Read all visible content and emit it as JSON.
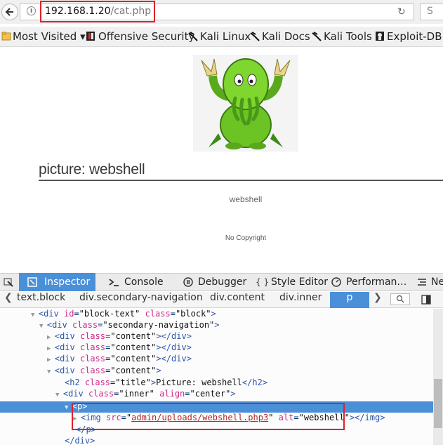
{
  "browser": {
    "url_host": "192.168.1.20",
    "url_path": "/cat.php",
    "search_label": "S"
  },
  "bookmarks": [
    {
      "label": "Most Visited ▾"
    },
    {
      "label": "Offensive Security"
    },
    {
      "label": "Kali Linux"
    },
    {
      "label": "Kali Docs"
    },
    {
      "label": "Kali Tools"
    },
    {
      "label": "Exploit-DB"
    }
  ],
  "page": {
    "title": "picture: webshell",
    "caption": "webshell",
    "copyright": "No Copyright"
  },
  "devtools": {
    "tabs": [
      "Inspector",
      "Console",
      "Debugger",
      "Style Editor",
      "Performan…",
      "Ne"
    ],
    "breadcrumbs": [
      "text.block",
      "div.secondary-navigation",
      "div.content",
      "div.inner",
      "p"
    ],
    "tree": {
      "l0": {
        "tag_open": "<div ",
        "a1": "id",
        "v1": "\"block-text\"",
        "a2": "class",
        "v2": "\"block\"",
        "close": ">"
      },
      "l1": {
        "tag_open": "<div ",
        "a1": "class",
        "v1": "\"secondary-navigation\"",
        "close": ">"
      },
      "l2": {
        "tag_open": "<div ",
        "a1": "class",
        "v1": "\"content\"",
        "close": "></div>"
      },
      "l3": {
        "tag_open": "<div ",
        "a1": "class",
        "v1": "\"content\"",
        "close": "></div>"
      },
      "l4": {
        "tag_open": "<div ",
        "a1": "class",
        "v1": "\"content\"",
        "close": "></div>"
      },
      "l5": {
        "tag_open": "<div ",
        "a1": "class",
        "v1": "\"content\"",
        "close": ">"
      },
      "l6": {
        "tag_open": "<h2 ",
        "a1": "class",
        "v1": "\"title\"",
        "close": ">",
        "text": "Picture: webshell",
        "end": "</h2>"
      },
      "l7": {
        "tag_open": "<div ",
        "a1": "class",
        "v1": "\"inner\"",
        "a2": "align",
        "v2": "\"center\"",
        "close": ">"
      },
      "l8": {
        "tag": "<p>"
      },
      "l9": {
        "tag_open": "<img ",
        "a1": "src",
        "v1_q1": "\"",
        "v1_link": "admin/uploads/webshell.php3",
        "v1_q2": "\"",
        "a2": "alt",
        "v2": "\"webshell\"",
        "close": "></img>"
      },
      "l10": {
        "tag": "</p>"
      },
      "l11": {
        "tag": "</div>"
      }
    }
  }
}
